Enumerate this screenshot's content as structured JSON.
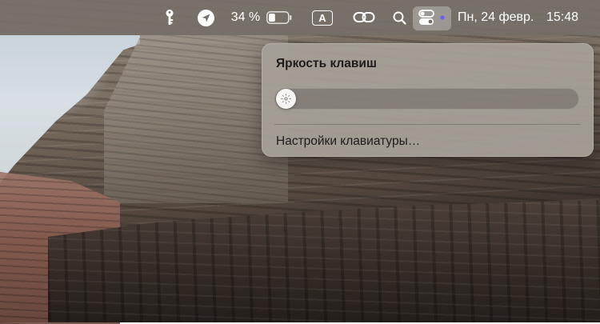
{
  "menubar": {
    "battery_percent": "34 %",
    "battery_level": 0.34,
    "input_source_label": "A",
    "date": "Пн, 24 февр.",
    "time": "15:48",
    "icons": [
      "key-icon",
      "location-arrow-icon",
      "battery-icon",
      "input-source-icon",
      "screen-mirroring-icon",
      "search-icon",
      "control-center-icon"
    ],
    "accent_dot_color": "#6b5cff"
  },
  "keyboard_brightness_panel": {
    "title": "Яркость клавиш",
    "brightness_level": 0.0,
    "settings_item": "Настройки клавиатуры…"
  },
  "colors": {
    "menubar_bg": "#767068",
    "panel_bg": "#a6a098"
  }
}
